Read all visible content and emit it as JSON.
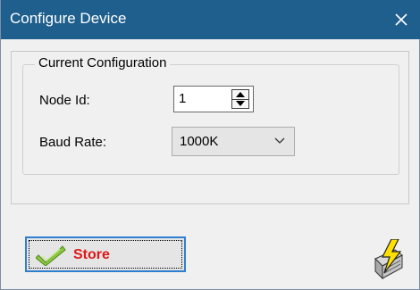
{
  "window": {
    "title": "Configure Device",
    "close_icon": "close-icon",
    "titlebar_color": "#1f5f8d"
  },
  "group": {
    "legend": "Current Configuration"
  },
  "node_id": {
    "label": "Node Id:",
    "value": "1",
    "spinner_icons": [
      "spin-up-icon",
      "spin-down-icon"
    ]
  },
  "baud_rate": {
    "label": "Baud Rate:",
    "selected": "1000K",
    "chevron_icon": "chevron-down-icon"
  },
  "store_button": {
    "label": "Store",
    "icon": "check-icon",
    "label_color": "#e01818"
  },
  "device_icon": "device-lightning-icon"
}
